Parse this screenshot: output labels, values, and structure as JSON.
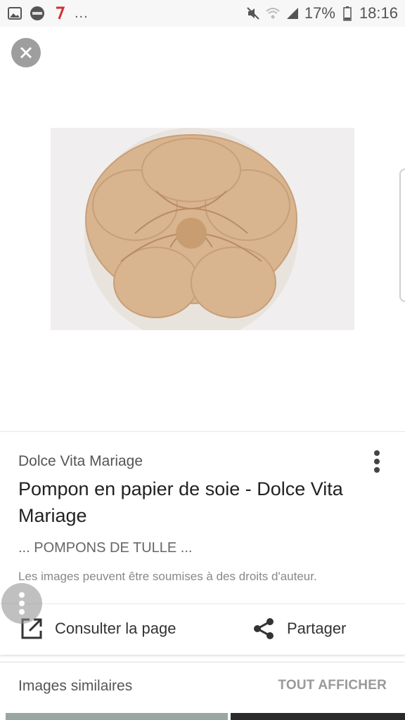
{
  "status_bar": {
    "battery": "17%",
    "time": "18:16",
    "overflow": "...",
    "left_icons": [
      "gallery-icon",
      "app-badge-icon",
      "tv-channel-icon"
    ],
    "right_icons": [
      "mute-icon",
      "wifi-icon",
      "signal-icon",
      "battery-icon"
    ]
  },
  "close": {
    "icon": "close-icon"
  },
  "image": {
    "description_icon": "paper-pompom-image"
  },
  "result": {
    "source": "Dolce Vita Mariage",
    "title": "Pompon en papier de soie - Dolce Vita Mariage",
    "snippet": "... POMPONS DE TULLE ...",
    "copyright": "Les images peuvent être soumises à des droits d'auteur."
  },
  "actions": {
    "visit_label": "Consulter la page",
    "share_label": "Partager"
  },
  "similar": {
    "title": "Images similaires",
    "see_all": "TOUT AFFICHER"
  },
  "colors": {
    "status_bar_bg": "#f7f7f7",
    "close_button_bg": "#9e9e9e",
    "see_all_text": "#999999"
  }
}
